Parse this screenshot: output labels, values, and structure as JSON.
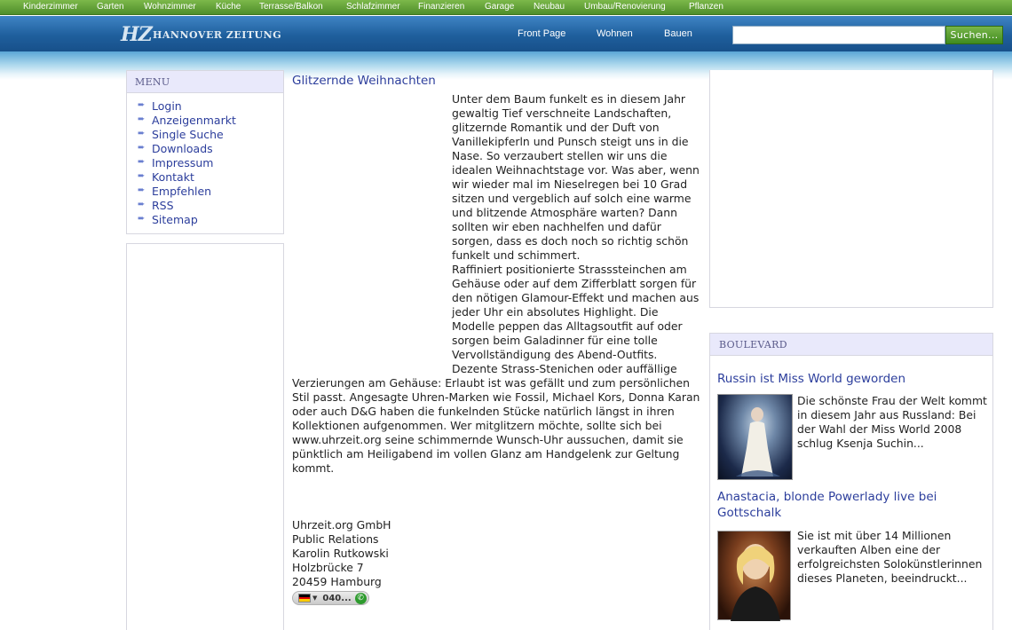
{
  "topnav": [
    "Kinderzimmer",
    "Garten",
    "Wohnzimmer",
    "Küche",
    "Terrasse/Balkon",
    "Schlafzimmer",
    "Finanzieren",
    "Garage",
    "Neubau",
    "Umbau/Renovierung",
    "Pflanzen"
  ],
  "header": {
    "logo_mark": "HZ",
    "logo_text": "HANNOVER ZEITUNG",
    "nav": [
      "Front Page",
      "Wohnen",
      "Bauen"
    ],
    "search_value": "",
    "search_button": "Suchen..."
  },
  "menu": {
    "title": "Menu",
    "items": [
      "Login",
      "Anzeigenmarkt",
      "Single Suche",
      "Downloads",
      "Impressum",
      "Kontakt",
      "Empfehlen",
      "RSS",
      "Sitemap"
    ]
  },
  "article": {
    "title": "Glitzernde Weihnachten",
    "para1": "Unter dem Baum funkelt es in diesem Jahr gewaltig Tief verschneite Landschaften, glitzernde Romantik und der Duft von Vanillekipferln und Punsch steigt uns in die Nase. So verzaubert stellen wir uns die idealen Weihnachtstage vor. Was aber, wenn wir wieder mal im Nieselregen bei 10 Grad sitzen und vergeblich auf solch eine warme und blitzende Atmosphäre warten? Dann sollten wir eben nachhelfen und dafür sorgen, dass es doch noch so richtig schön funkelt und schimmert.",
    "para2": "Raffiniert positionierte Strasssteinchen am Gehäuse oder auf dem Zifferblatt sorgen für den nötigen Glamour-Effekt und machen aus jeder Uhr ein absolutes Highlight. Die Modelle peppen das Alltagsoutfit auf oder sorgen beim Galadinner für eine tolle Vervollständigung des Abend-Outfits. Dezente Strass-Stenichen oder auffällige Verzierungen am Gehäuse: Erlaubt ist was gefällt und zum persönlichen Stil passt. Angesagte Uhren-Marken wie Fossil, Michael Kors, Donna Karan oder auch D&G haben die funkelnden Stücke natürlich längst in ihren Kollektionen aufgenommen.  Wer mitglitzern möchte, sollte sich bei www.uhrzeit.org seine schimmernde Wunsch-Uhr aussuchen, damit sie pünktlich am Heiligabend im vollen Glanz am Handgelenk zur Geltung kommt.",
    "address": [
      "Uhrzeit.org GmbH",
      "Public Relations",
      "Karolin Rutkowski",
      "Holzbrücke 7",
      "20459 Hamburg"
    ],
    "phone": "040..."
  },
  "boulevard": {
    "title": "Boulevard",
    "items": [
      {
        "title": "Russin ist Miss World geworden",
        "text": "Die schönste Frau der Welt kommt in diesem Jahr aus Russland: Bei der Wahl der Miss World 2008 schlug Ksenja Suchin..."
      },
      {
        "title": "Anastacia, blonde Powerlady live bei Gottschalk",
        "text": "Sie ist mit über 14 Millionen verkauften Alben eine der erfolgreichsten Solokünstlerinnen dieses Planeten, beeindruckt..."
      }
    ]
  },
  "colors": {
    "link": "#2c3e9c",
    "topbar": "#5a9a32",
    "header": "#1f5f9d",
    "box_head": "#e9e9fb"
  }
}
